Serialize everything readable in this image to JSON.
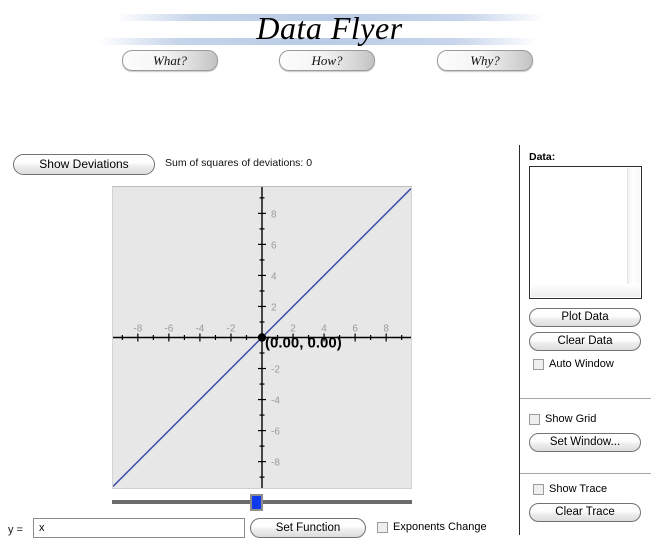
{
  "header": {
    "title": "Data Flyer",
    "nav": [
      {
        "label": "What?"
      },
      {
        "label": "How?"
      },
      {
        "label": "Why?"
      }
    ]
  },
  "toolbar": {
    "show_deviations_label": "Show Deviations",
    "sum_of_squares_text": "Sum of squares of deviations: 0"
  },
  "graph": {
    "point_label": "(0.00, 0.00)",
    "line_color": "#3b4fa8",
    "background_color": "#e7e7e7",
    "axis_color": "#000000",
    "tick_label_color": "#9a9a9a"
  },
  "slider": {
    "value_position_percent": 48
  },
  "function_bar": {
    "y_label": "y =",
    "function_value": "x",
    "function_placeholder": "x",
    "set_function_label": "Set Function",
    "exponents_change_label": "Exponents Change",
    "exponents_change_checked": false
  },
  "right_panel": {
    "data_label": "Data:",
    "data_value": "",
    "data_placeholder": "",
    "plot_data_label": "Plot Data",
    "clear_data_label": "Clear Data",
    "auto_window_label": "Auto Window",
    "auto_window_checked": false,
    "show_grid_label": "Show Grid",
    "show_grid_checked": false,
    "set_window_label": "Set Window...",
    "show_trace_label": "Show Trace",
    "show_trace_checked": false,
    "clear_trace_label": "Clear Trace"
  },
  "chart_data": {
    "type": "line",
    "title": "",
    "xlabel": "",
    "ylabel": "",
    "xlim": [
      -9.6,
      9.6
    ],
    "ylim": [
      -9.7,
      9.7
    ],
    "grid": false,
    "legend": "none",
    "expression": "y = x",
    "series": [
      {
        "name": "y = x",
        "color": "#3b4fa8",
        "x": [
          -9.6,
          9.6
        ],
        "y": [
          -9.6,
          9.6
        ]
      }
    ],
    "points": [
      {
        "x": 0,
        "y": 0,
        "label": "(0.00, 0.00)"
      }
    ],
    "x_ticks": [
      -8,
      -6,
      -4,
      -2,
      2,
      4,
      6,
      8
    ],
    "y_ticks": [
      8,
      6,
      4,
      2,
      -2,
      -4,
      -6,
      -8
    ],
    "x_tick_labels": [
      "-8",
      "-6",
      "-4",
      "-2",
      "2",
      "4",
      "6",
      "8"
    ],
    "y_tick_labels": [
      "8",
      "6",
      "4",
      "2",
      "-2",
      "-4",
      "-6",
      "-8"
    ],
    "minor_tick_step": 1
  }
}
